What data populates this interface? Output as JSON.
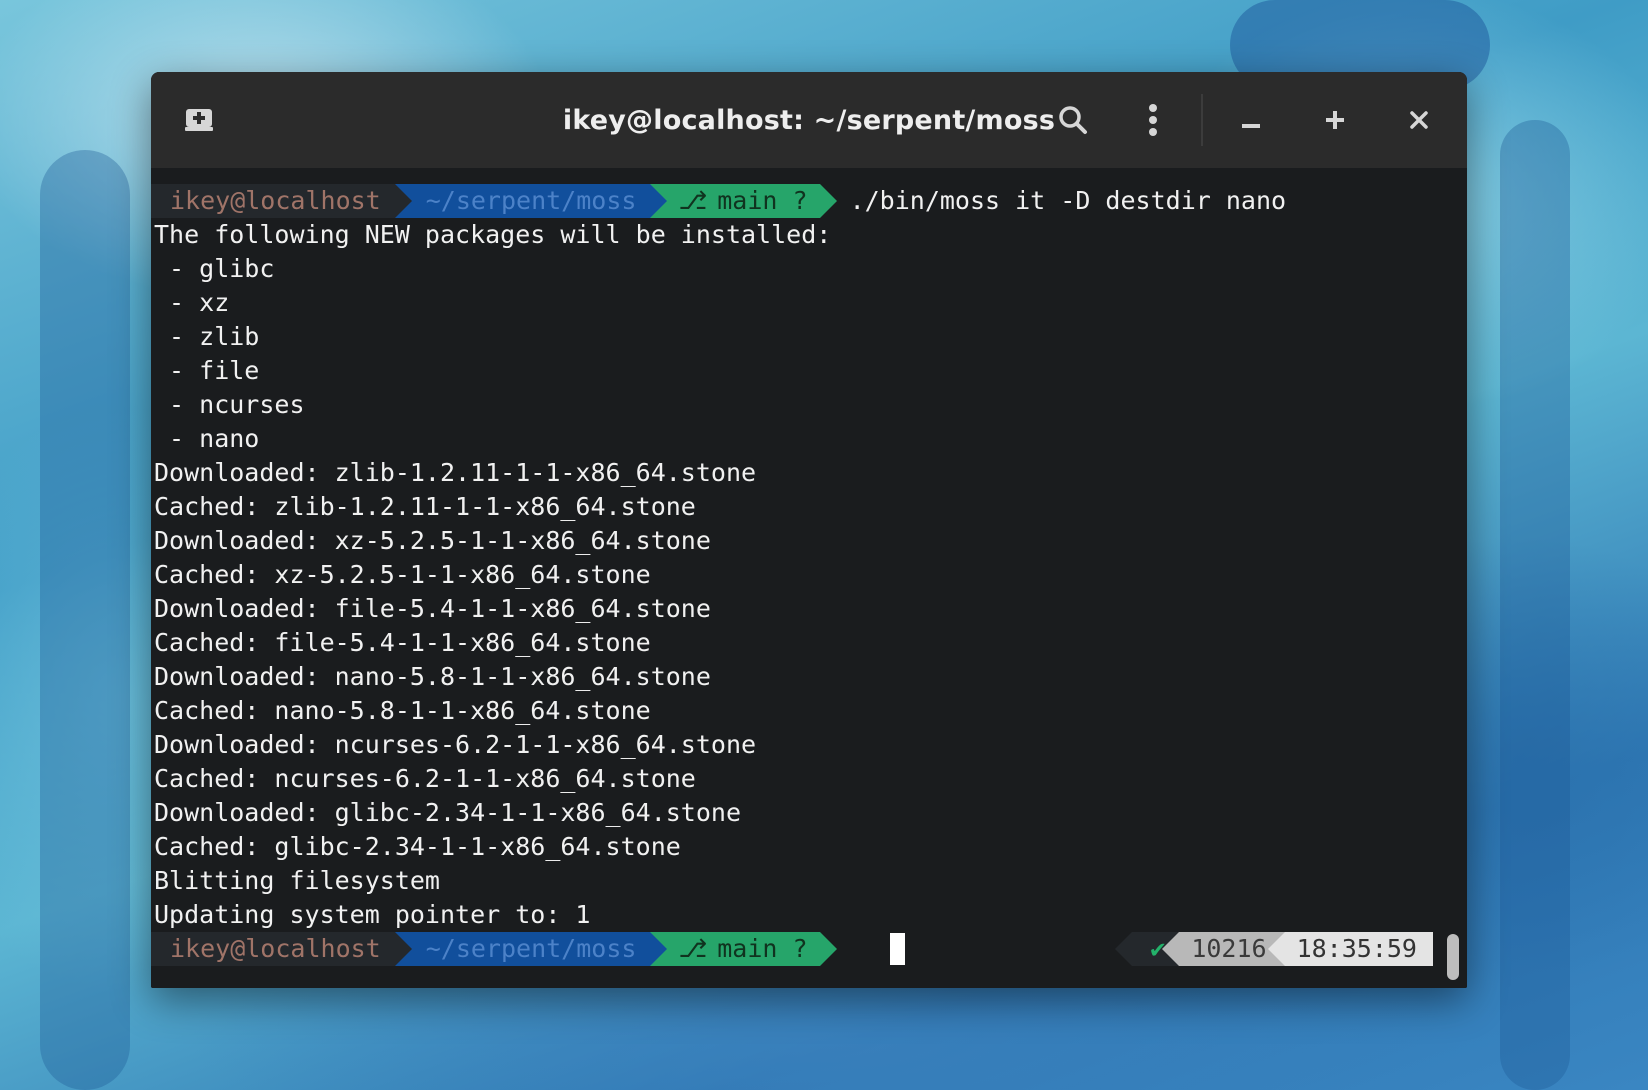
{
  "window": {
    "title": "ikey@localhost: ~/serpent/moss"
  },
  "titlebar": {
    "icons": [
      "new-tab-icon",
      "search-icon",
      "menu-icon",
      "minimize-icon",
      "maximize-icon",
      "close-icon"
    ]
  },
  "prompt_top": {
    "user": "ikey@localhost",
    "dir": "~/serpent/moss",
    "branch": "main ?",
    "command": "./bin/moss it -D destdir nano"
  },
  "output": {
    "lines": [
      "The following NEW packages will be installed:",
      " - glibc",
      " - xz",
      " - zlib",
      " - file",
      " - ncurses",
      " - nano",
      "Downloaded: zlib-1.2.11-1-1-x86_64.stone",
      "Cached: zlib-1.2.11-1-1-x86_64.stone",
      "Downloaded: xz-5.2.5-1-1-x86_64.stone",
      "Cached: xz-5.2.5-1-1-x86_64.stone",
      "Downloaded: file-5.4-1-1-x86_64.stone",
      "Cached: file-5.4-1-1-x86_64.stone",
      "Downloaded: nano-5.8-1-1-x86_64.stone",
      "Cached: nano-5.8-1-1-x86_64.stone",
      "Downloaded: ncurses-6.2-1-1-x86_64.stone",
      "Cached: ncurses-6.2-1-1-x86_64.stone",
      "Downloaded: glibc-2.34-1-1-x86_64.stone",
      "Cached: glibc-2.34-1-1-x86_64.stone",
      "Blitting filesystem",
      "Updating system pointer to: 1"
    ]
  },
  "prompt_bottom": {
    "user": "ikey@localhost",
    "dir": "~/serpent/moss",
    "branch": "main ?",
    "status": "✔",
    "pid": "10216",
    "time": "18:35:59"
  },
  "colors": {
    "user_segment": "#24282c",
    "dir_segment": "#114f9c",
    "git_segment": "#26a56a",
    "status_ok": "#23b26a",
    "terminal_bg": "#1a1c1e",
    "titlebar_bg": "#2b2b2b"
  }
}
